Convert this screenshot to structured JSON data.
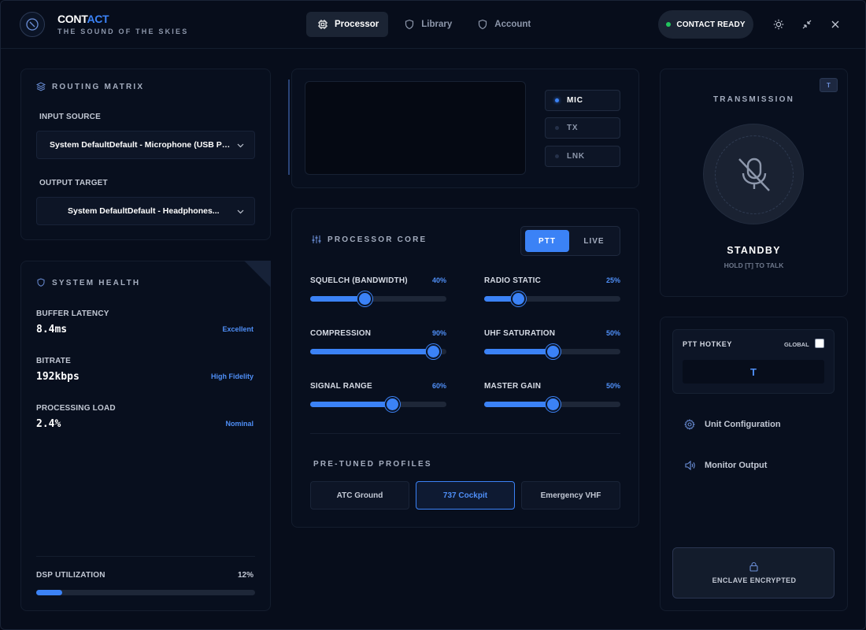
{
  "brand": {
    "title_main": "CONT",
    "title_accent": "ACT",
    "subtitle": "THE SOUND OF THE SKIES"
  },
  "nav": {
    "tabs": [
      {
        "label": "Processor"
      },
      {
        "label": "Library"
      },
      {
        "label": "Account"
      }
    ]
  },
  "status": {
    "label": "CONTACT READY",
    "color": "#22c55e"
  },
  "routing": {
    "title": "ROUTING MATRIX",
    "input_label": "INPUT SOURCE",
    "input_value": "System DefaultDefault - Microphone (USB Pn...",
    "output_label": "OUTPUT TARGET",
    "output_value": "System DefaultDefault - Headphones..."
  },
  "health": {
    "title": "SYSTEM HEALTH",
    "metrics": [
      {
        "label": "BUFFER LATENCY",
        "value": "8.4ms",
        "tag": "Excellent"
      },
      {
        "label": "BITRATE",
        "value": "192kbps",
        "tag": "High Fidelity"
      },
      {
        "label": "PROCESSING LOAD",
        "value": "2.4%",
        "tag": "Nominal"
      }
    ],
    "dsp_label": "DSP UTILIZATION",
    "dsp_value": "12%",
    "dsp_fraction": 0.12
  },
  "indicators": [
    {
      "label": "MIC",
      "on": true
    },
    {
      "label": "TX",
      "on": false
    },
    {
      "label": "LNK",
      "on": false
    }
  ],
  "processor": {
    "title": "PROCESSOR CORE",
    "mode_ptt": "PTT",
    "mode_live": "LIVE",
    "sliders": [
      {
        "label": "SQUELCH (BANDWIDTH)",
        "pct": "40%",
        "value": 0.4
      },
      {
        "label": "RADIO STATIC",
        "pct": "25%",
        "value": 0.25
      },
      {
        "label": "COMPRESSION",
        "pct": "90%",
        "value": 0.9
      },
      {
        "label": "UHF SATURATION",
        "pct": "50%",
        "value": 0.5
      },
      {
        "label": "SIGNAL RANGE",
        "pct": "60%",
        "value": 0.6
      },
      {
        "label": "MASTER GAIN",
        "pct": "50%",
        "value": 0.5
      }
    ],
    "profiles_title": "PRE-TUNED PROFILES",
    "profiles": [
      {
        "label": "ATC Ground"
      },
      {
        "label": "737 Cockpit"
      },
      {
        "label": "Emergency VHF"
      }
    ]
  },
  "transmission": {
    "title": "TRANSMISSION",
    "badge": "T",
    "state": "STANDBY",
    "hint": "HOLD [T] TO TALK"
  },
  "hotkey": {
    "title": "PTT HOTKEY",
    "global_label": "GLOBAL",
    "key": "T"
  },
  "side_menu": {
    "unit_config": "Unit Configuration",
    "monitor_output": "Monitor Output"
  },
  "enclave": {
    "label": "ENCLAVE ENCRYPTED"
  },
  "colors": {
    "accent": "#3b82f6",
    "background": "#070d1b"
  }
}
